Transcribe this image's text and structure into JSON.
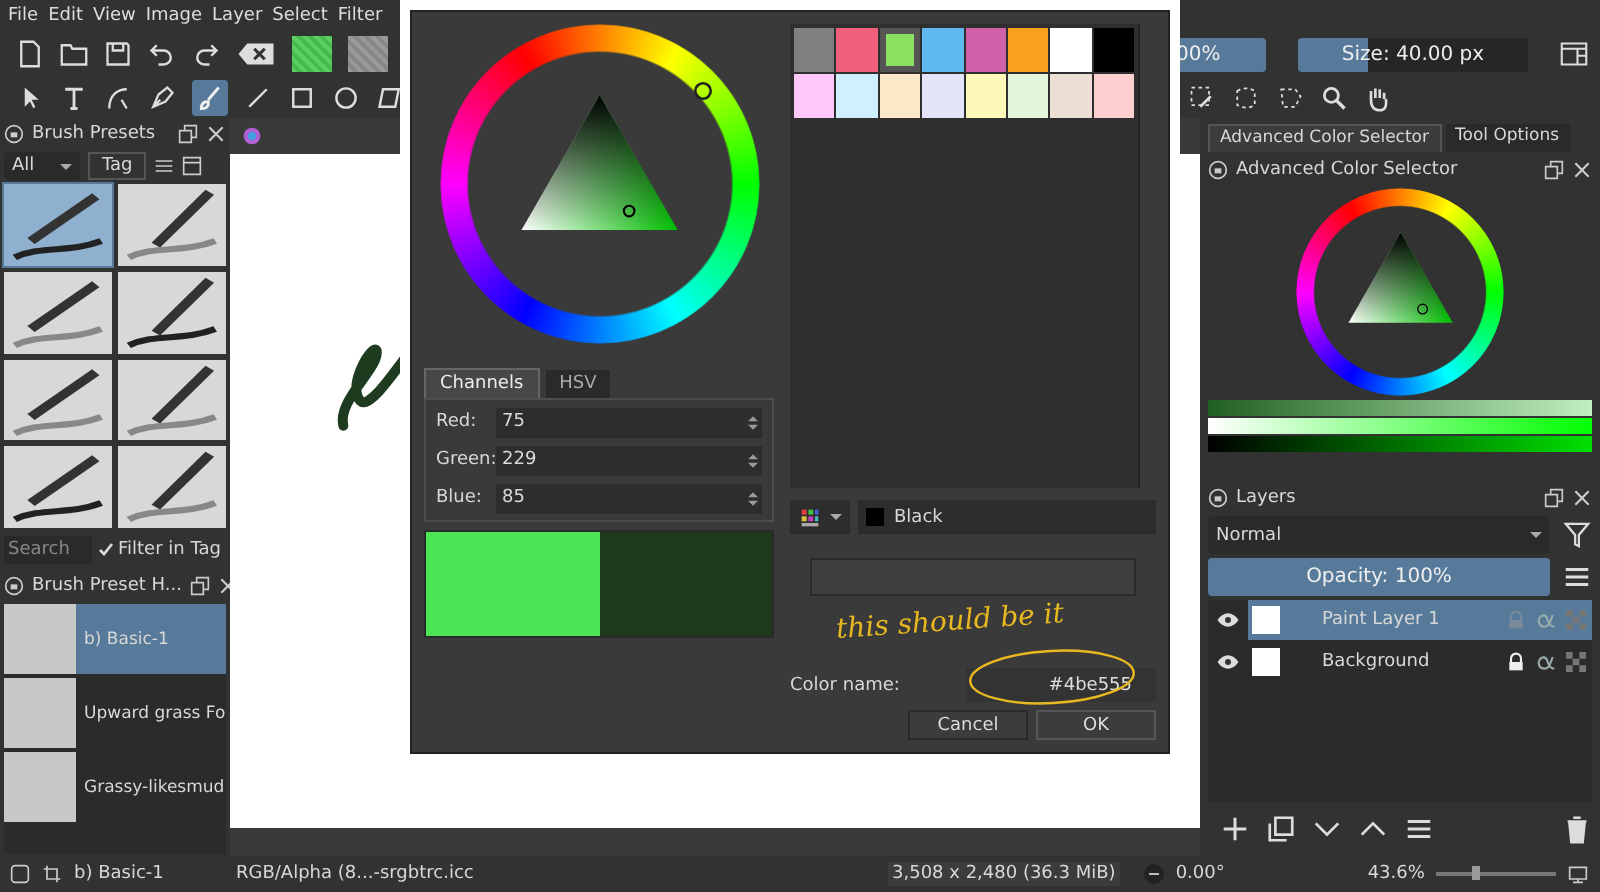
{
  "menu": [
    "File",
    "Edit",
    "View",
    "Image",
    "Layer",
    "Select",
    "Filter"
  ],
  "toolbar": {
    "opacity": {
      "value": "00%",
      "level": 1
    },
    "size": {
      "value": "Size: 40.00 px",
      "level": 0.3
    }
  },
  "brush_presets": {
    "title": "Brush Presets",
    "filter": "All",
    "tag": "Tag",
    "presets": [
      {
        "selected": true
      },
      {
        "selected": false
      },
      {
        "selected": false
      },
      {
        "selected": false
      },
      {
        "selected": false
      },
      {
        "selected": false
      },
      {
        "selected": false
      },
      {
        "selected": false
      }
    ],
    "search_placeholder": "Search",
    "filter_in_tag": {
      "label": "Filter in Tag",
      "checked": true
    }
  },
  "brush_history": {
    "title": "Brush Preset H...",
    "items": [
      {
        "name": "b) Basic-1",
        "selected": true
      },
      {
        "name": "Upward grass Fo",
        "selected": false
      },
      {
        "name": "Grassy-likesmud",
        "selected": false
      }
    ]
  },
  "dialog": {
    "palette": [
      {
        "color": "#808080",
        "selected": false
      },
      {
        "color": "#f0607a",
        "selected": false
      },
      {
        "color": "#8ae060",
        "selected": true
      },
      {
        "color": "#60b8f0",
        "selected": false
      },
      {
        "color": "#d060a8",
        "selected": false
      },
      {
        "color": "#f8a020",
        "selected": false
      },
      {
        "color": "#ffffff",
        "selected": false
      },
      {
        "color": "#000000",
        "selected": false
      },
      {
        "color": "#ffc8f8",
        "selected": false
      },
      {
        "color": "#d0f0ff",
        "selected": false
      },
      {
        "color": "#fae8c8",
        "selected": false
      },
      {
        "color": "#e4e4fa",
        "selected": false
      },
      {
        "color": "#fdf8b8",
        "selected": false
      },
      {
        "color": "#e4f6da",
        "selected": false
      },
      {
        "color": "#ece0d4",
        "selected": false
      },
      {
        "color": "#fdd0d0",
        "selected": false
      }
    ],
    "tabs": [
      {
        "label": "Channels",
        "selected": true
      },
      {
        "label": "HSV",
        "selected": false
      }
    ],
    "channels": [
      {
        "label": "Red:",
        "value": "75"
      },
      {
        "label": "Green:",
        "value": "229"
      },
      {
        "label": "Blue:",
        "value": "85"
      }
    ],
    "preview": [
      {
        "color": "#4be555"
      },
      {
        "color": "#1e3a1f"
      }
    ],
    "palette_name": "Black",
    "color_name_label": "Color name:",
    "color_name": "#4be555",
    "buttons": [
      "Cancel",
      "OK"
    ],
    "annotation": "this should be it"
  },
  "right_panel": {
    "tabs": [
      {
        "label": "Advanced Color Selector",
        "selected": true
      },
      {
        "label": "Tool Options",
        "selected": false
      }
    ],
    "color_selector_title": "Advanced Color Selector",
    "layers": {
      "title": "Layers",
      "blend_mode": "Normal",
      "opacity": {
        "label": "Opacity:  100%",
        "level": 1
      },
      "items": [
        {
          "name": "Paint Layer 1",
          "selected": true,
          "locked": false
        },
        {
          "name": "Background",
          "selected": false,
          "locked": true
        }
      ]
    }
  },
  "status_bar": {
    "brush": "b) Basic-1",
    "color_space": "RGB/Alpha (8...-srgbtrc.icc",
    "size": "3,508 x 2,480 (36.3 MiB)",
    "rotation": "0.00°",
    "zoom": "43.6%",
    "zoom_level": {
      "level": 0.3
    }
  }
}
